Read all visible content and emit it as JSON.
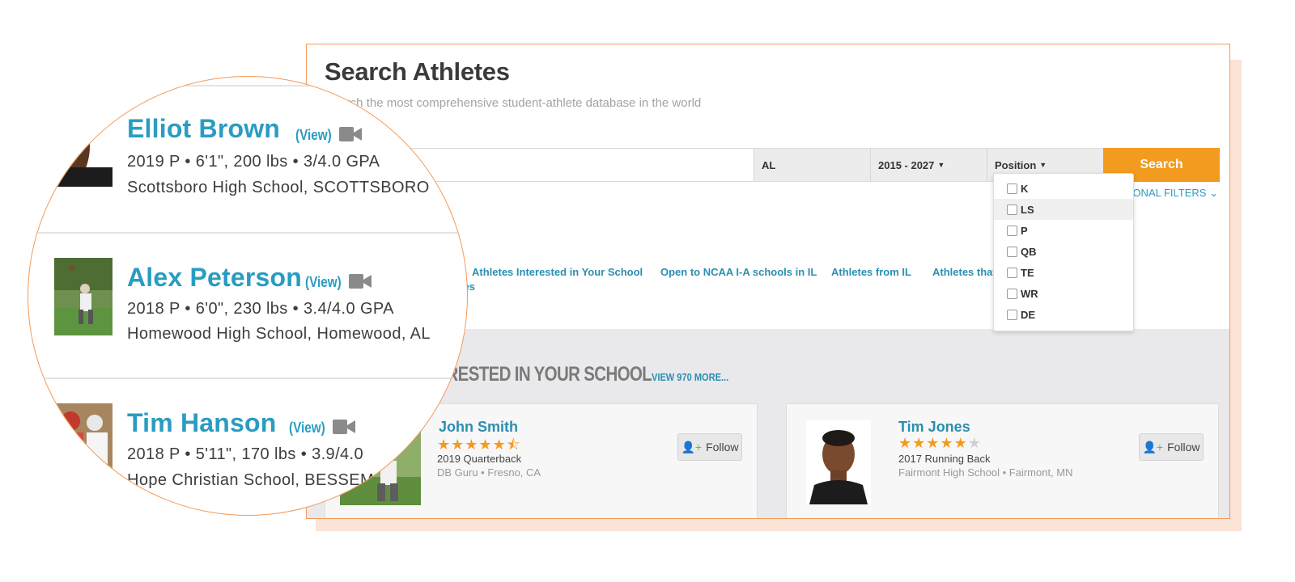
{
  "page": {
    "title": "Search Athletes",
    "subtitle": "Search the most comprehensive student-athlete database in the world"
  },
  "search": {
    "input_value": "",
    "state_filter": "AL",
    "year_filter": "2015 - 2027",
    "position_filter": "Position",
    "button_label": "Search",
    "additional_filters_label": "ADDITIONAL FILTERS"
  },
  "position_dropdown": {
    "options": [
      "K",
      "LS",
      "P",
      "QB",
      "TE",
      "WR",
      "DE"
    ],
    "highlighted": "LS"
  },
  "quick_links": {
    "items": [
      "Athletes Interested in Your School",
      "Open to NCAA I-A schools in IL",
      "Athletes from IL",
      "Athletes that"
    ],
    "wrapped_tail": "etes"
  },
  "section": {
    "title": "ATHLETES INTERESTED IN YOUR SCHOOL",
    "view_more": "VIEW 970 MORE..."
  },
  "cards": [
    {
      "name": "John Smith",
      "rating": 4.5,
      "stars_max": 5,
      "line1": "2019 Quarterback",
      "line2": "DB Guru • Fresno, CA",
      "follow_label": "Follow"
    },
    {
      "name": "Tim Jones",
      "rating": 5,
      "stars_max": 6,
      "line1": "2017 Running Back",
      "line2": "Fairmont High School • Fairmont, MN",
      "follow_label": "Follow"
    }
  ],
  "magnified_list": [
    {
      "name": "Elliot Brown",
      "view_label": "(View)",
      "stats": "2019 P •  6'1\", 200 lbs •  3/4.0 GPA",
      "school": "Scottsboro High School, SCOTTSBORO"
    },
    {
      "name": "Alex Peterson",
      "view_label": "(View)",
      "stats": "2018 P •  6'0\", 230 lbs •  3.4/4.0 GPA",
      "school": "Homewood High School, Homewood, AL"
    },
    {
      "name": "Tim Hanson",
      "view_label": "(View)",
      "stats": "2018 P •  5'11\", 170 lbs •  3.9/4.0",
      "school": "Hope Christian School, BESSEMER"
    }
  ],
  "colors": {
    "accent_orange": "#f29b1e",
    "link_blue": "#2a8fb0",
    "panel_border": "#f39a58",
    "shadow_card": "#fbe3d6"
  },
  "icons": [
    "caret-down-icon",
    "chevron-down-icon",
    "video-camera-icon",
    "star-icon",
    "user-plus-icon",
    "checkbox-icon"
  ]
}
